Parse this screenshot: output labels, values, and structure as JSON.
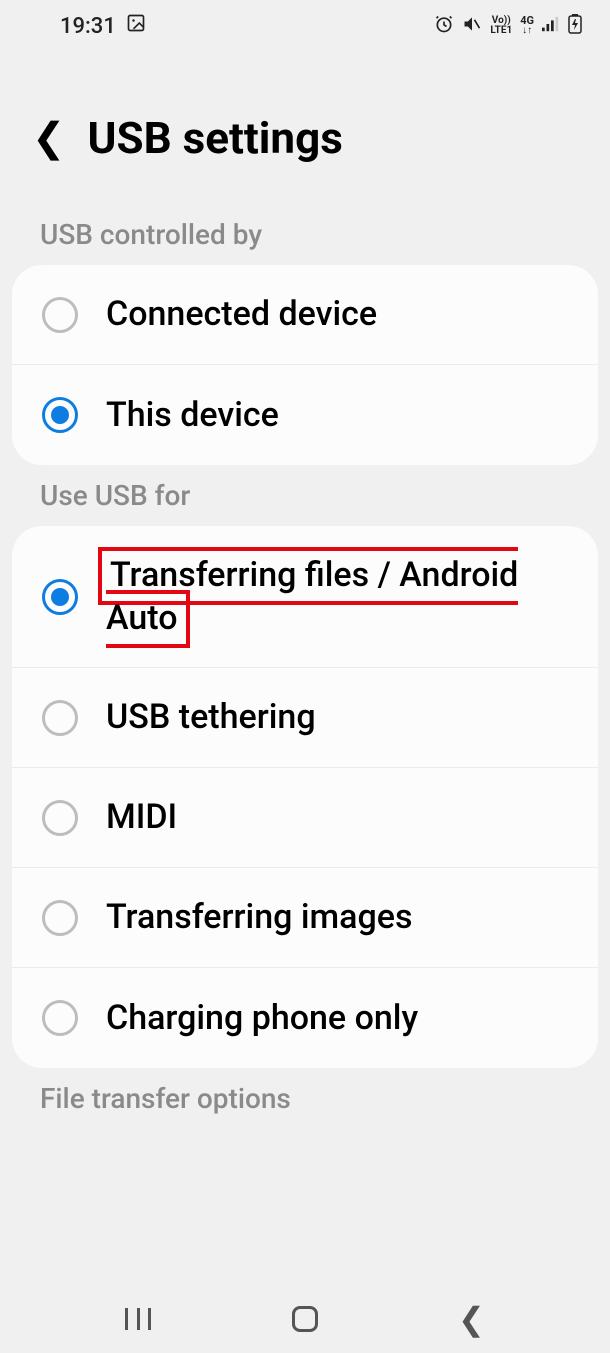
{
  "status": {
    "time": "19:31",
    "volte_top": "Vo))",
    "volte_bottom": "LTE1",
    "network": "4G"
  },
  "header": {
    "title": "USB settings"
  },
  "sections": {
    "controlled_by": {
      "title": "USB controlled by",
      "options": [
        {
          "label": "Connected device"
        },
        {
          "label": "This device"
        }
      ]
    },
    "use_for": {
      "title": "Use USB for",
      "options": [
        {
          "label": "Transferring files / Android Auto"
        },
        {
          "label": "USB tethering"
        },
        {
          "label": "MIDI"
        },
        {
          "label": "Transferring images"
        },
        {
          "label": "Charging phone only"
        }
      ]
    },
    "file_transfer": {
      "title": "File transfer options"
    }
  }
}
